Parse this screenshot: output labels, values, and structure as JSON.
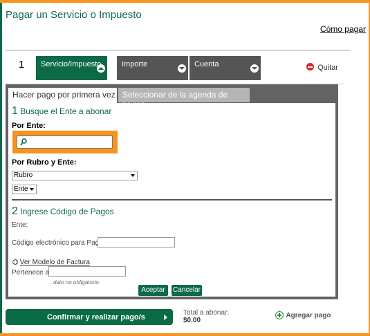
{
  "header": {
    "title": "Pagar un Servicio o Impuesto",
    "help_link": "Cómo pagar"
  },
  "steps": {
    "row_number": "1",
    "items": [
      {
        "label": "Servicio/Impuesto",
        "state": "active",
        "icon": "chevron-up-icon"
      },
      {
        "label": "Importe",
        "state": "inactive",
        "icon": "chevron-down-icon"
      },
      {
        "label": "Cuenta",
        "state": "inactive",
        "icon": "chevron-down-icon"
      }
    ],
    "remove_label": "Quitar"
  },
  "tabs": [
    {
      "label": "Hacer pago por primera vez",
      "active": true
    },
    {
      "label": "Seleccionar de la agenda de pagos",
      "active": false
    }
  ],
  "section1": {
    "number": "1",
    "title": "Busque el Ente a abonar",
    "by_entity_label": "Por Ente:",
    "search_value": "",
    "search_placeholder": "",
    "by_category_label": "Por Rubro y Ente:",
    "category_select": "Rubro",
    "entity_select": "Ente"
  },
  "section2": {
    "number": "2",
    "title": "Ingrese Código de Pagos",
    "entity_label": "Ente:",
    "code_label": "Código electrónico para Pagar",
    "code_value": "",
    "invoice_link": "Ver Modelo de Factura",
    "belongs_label": "Pertenece a:",
    "belongs_value": "",
    "optional_hint": "dato no obligatorio",
    "accept_label": "Aceptar",
    "cancel_label": "Cancelar"
  },
  "footer": {
    "confirm_label": "Confirmar y realizar pago/s",
    "total_label": "Total a abonar:",
    "total_value": "$0.00",
    "add_payment_label": "Agregar pago"
  },
  "colors": {
    "brand_green": "#0b6b47",
    "accent_orange": "#f7941d",
    "panel_gray": "#636363",
    "remove_red": "#d9232e"
  }
}
